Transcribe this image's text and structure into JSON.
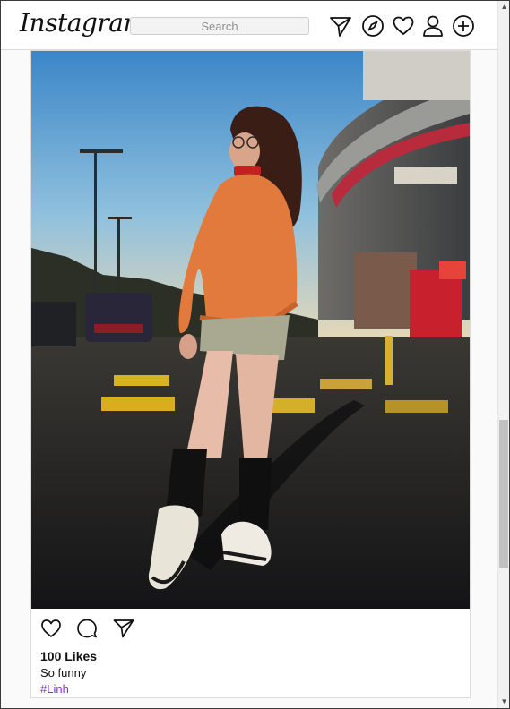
{
  "app": {
    "logo_text": "Instagram"
  },
  "header": {
    "search_placeholder": "Search",
    "icons": [
      "send-icon",
      "explore-compass-icon",
      "heart-icon",
      "profile-icon",
      "new-post-plus-icon"
    ]
  },
  "post": {
    "likes_text": "100 Likes",
    "caption": "So funny",
    "hashtag": "#Linh",
    "actions": [
      "like-heart-icon",
      "comment-bubble-icon",
      "share-send-icon"
    ]
  },
  "colors": {
    "hashtag": "#8a2be2",
    "border": "#dbdbdb",
    "background": "#fafafa"
  }
}
